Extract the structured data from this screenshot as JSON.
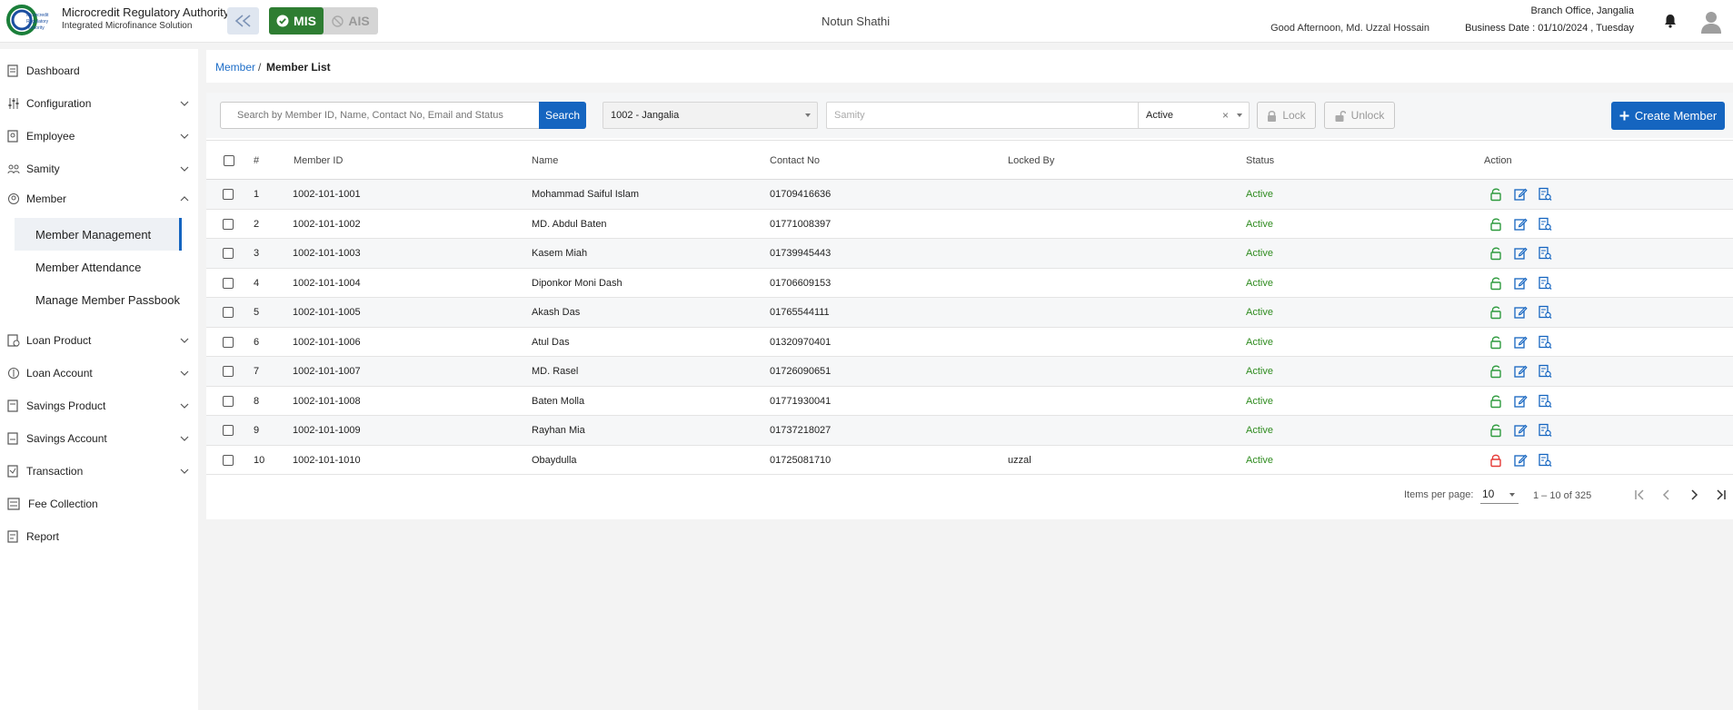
{
  "header": {
    "logo_text": "Microcredit Regulatory Authority",
    "title": "Microcredit Regulatory Authority",
    "subtitle": "Integrated Microfinance Solution",
    "mode_mis": "MIS",
    "mode_ais": "AIS",
    "org_name": "Notun Shathi",
    "greeting": "Good Afternoon, Md. Uzzal Hossain",
    "branch": "Branch Office, Jangalia",
    "business_date": "Business Date : 01/10/2024 , Tuesday"
  },
  "sidebar": {
    "items": [
      {
        "label": "Dashboard",
        "icon": "dashboard-icon"
      },
      {
        "label": "Configuration",
        "icon": "sliders-icon"
      },
      {
        "label": "Employee",
        "icon": "employee-icon"
      },
      {
        "label": "Samity",
        "icon": "group-icon"
      },
      {
        "label": "Member",
        "icon": "member-icon"
      },
      {
        "label": "Loan Product",
        "icon": "loan-product-icon"
      },
      {
        "label": "Loan Account",
        "icon": "loan-account-icon"
      },
      {
        "label": "Savings Product",
        "icon": "savings-product-icon"
      },
      {
        "label": "Savings Account",
        "icon": "savings-account-icon"
      },
      {
        "label": "Transaction",
        "icon": "transaction-icon"
      },
      {
        "label": "Fee Collection",
        "icon": "fee-icon"
      },
      {
        "label": "Report",
        "icon": "report-icon"
      }
    ],
    "member_sub": [
      {
        "label": "Member Management"
      },
      {
        "label": "Member Attendance"
      },
      {
        "label": "Manage Member Passbook"
      }
    ]
  },
  "breadcrumb": {
    "link": "Member",
    "separator": "/",
    "current": "Member List"
  },
  "toolbar": {
    "search_placeholder": "Search by Member ID, Name, Contact No, Email and Status",
    "search_label": "Search",
    "branch_value": "1002 - Jangalia",
    "samity_placeholder": "Samity",
    "status_value": "Active",
    "lock_label": "Lock",
    "unlock_label": "Unlock",
    "create_label": "Create Member"
  },
  "table": {
    "columns": [
      "#",
      "Member ID",
      "Name",
      "Contact No",
      "Locked By",
      "Status",
      "Action"
    ],
    "rows": [
      {
        "n": "1",
        "id": "1002-101-1001",
        "name": "Mohammad Saiful Islam",
        "contact": "01709416636",
        "locked_by": "",
        "status": "Active",
        "locked": false
      },
      {
        "n": "2",
        "id": "1002-101-1002",
        "name": "MD. Abdul Baten",
        "contact": "01771008397",
        "locked_by": "",
        "status": "Active",
        "locked": false
      },
      {
        "n": "3",
        "id": "1002-101-1003",
        "name": "Kasem Miah",
        "contact": "01739945443",
        "locked_by": "",
        "status": "Active",
        "locked": false
      },
      {
        "n": "4",
        "id": "1002-101-1004",
        "name": "Diponkor Moni Dash",
        "contact": "01706609153",
        "locked_by": "",
        "status": "Active",
        "locked": false
      },
      {
        "n": "5",
        "id": "1002-101-1005",
        "name": "Akash Das",
        "contact": "01765544111",
        "locked_by": "",
        "status": "Active",
        "locked": false
      },
      {
        "n": "6",
        "id": "1002-101-1006",
        "name": "Atul Das",
        "contact": "01320970401",
        "locked_by": "",
        "status": "Active",
        "locked": false
      },
      {
        "n": "7",
        "id": "1002-101-1007",
        "name": "MD. Rasel",
        "contact": "01726090651",
        "locked_by": "",
        "status": "Active",
        "locked": false
      },
      {
        "n": "8",
        "id": "1002-101-1008",
        "name": "Baten Molla",
        "contact": "01771930041",
        "locked_by": "",
        "status": "Active",
        "locked": false
      },
      {
        "n": "9",
        "id": "1002-101-1009",
        "name": "Rayhan Mia",
        "contact": "01737218027",
        "locked_by": "",
        "status": "Active",
        "locked": false
      },
      {
        "n": "10",
        "id": "1002-101-1010",
        "name": "Obaydulla",
        "contact": "01725081710",
        "locked_by": "uzzal",
        "status": "Active",
        "locked": true
      }
    ]
  },
  "pagination": {
    "items_per_page_label": "Items per page:",
    "items_per_page": "10",
    "range": "1 – 10 of 325"
  },
  "colors": {
    "primary": "#1565c0",
    "success": "#2e7d32",
    "status_active": "#2e8b1e",
    "lock_red": "#e53935",
    "unlock_green": "#2e9b3e"
  }
}
